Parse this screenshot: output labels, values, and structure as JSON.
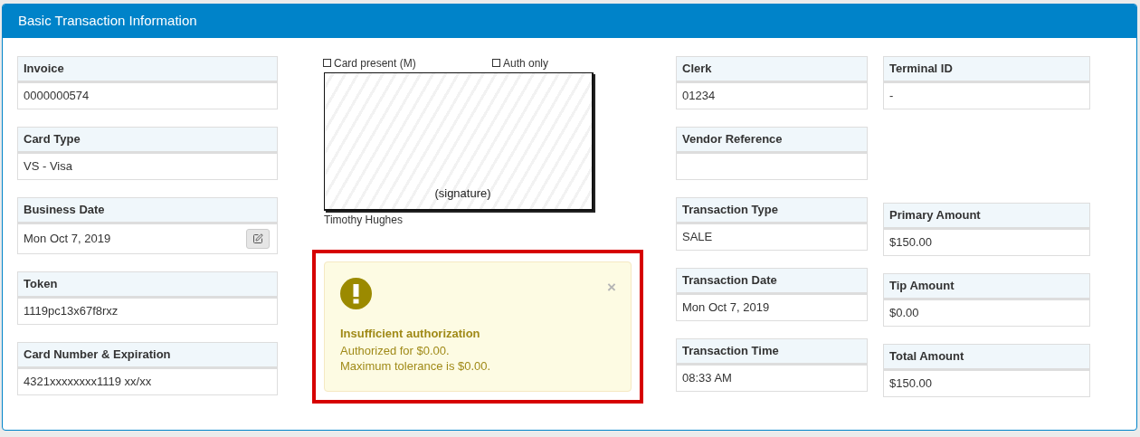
{
  "panel": {
    "title": "Basic Transaction Information"
  },
  "left_fields": [
    {
      "label": "Invoice",
      "value": "0000000574"
    },
    {
      "label": "Card Type",
      "value": "VS - Visa"
    },
    {
      "label": "Business Date",
      "value": "Mon Oct 7, 2019",
      "kind": "editable"
    },
    {
      "label": "Token",
      "value": "1119pc13x67f8rxz"
    },
    {
      "label": "Card Number & Expiration",
      "value": "4321xxxxxxxx1119 xx/xx"
    }
  ],
  "signature": {
    "checkboxes": [
      {
        "label": "Card present (M)",
        "checked": false
      },
      {
        "label": "Auth only",
        "checked": false
      }
    ],
    "caption": "(signature)",
    "signer": "Timothy Hughes"
  },
  "alert": {
    "title": "Insufficient authorization",
    "lines": [
      "Authorized for $0.00.",
      "Maximum tolerance is $0.00."
    ],
    "close": "×",
    "highlighted": true
  },
  "middle_fields": [
    {
      "label": "Clerk",
      "value": "01234"
    },
    {
      "label": "Vendor Reference"
    },
    {
      "label": "Transaction Type",
      "value": "SALE"
    },
    {
      "label": "Transaction Date",
      "value": "Mon Oct 7, 2019"
    },
    {
      "label": "Transaction Time",
      "value": "08:33 AM"
    }
  ],
  "right_fields": [
    {
      "label": "Terminal ID",
      "value": "-"
    },
    {
      "label": "Primary Amount",
      "value": "$150.00"
    },
    {
      "label": "Tip Amount",
      "value": "$0.00"
    },
    {
      "label": "Total Amount",
      "value": "$150.00"
    }
  ]
}
